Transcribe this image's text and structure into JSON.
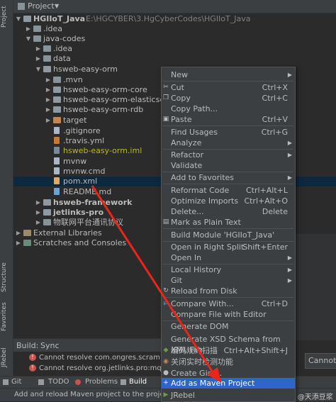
{
  "sidebar": {
    "project_tab": "Project",
    "structure_tab": "Structure",
    "favorites_tab": "Favorites",
    "jrebel_tab": "JRebel"
  },
  "header": {
    "title": "Project"
  },
  "tree": {
    "root_name": "HGIIoT_Java",
    "root_path": "E:\\HGCYBER\\3.HgCyberCodes\\HGIIoT_Java",
    "items": [
      ".idea",
      "java-codes",
      ".idea",
      "data",
      "hsweb-easy-orm",
      ".mvn",
      "hsweb-easy-orm-core",
      "hsweb-easy-orm-elasticsearch",
      "hsweb-easy-orm-rdb",
      "target",
      ".gitignore",
      ".travis.yml",
      "hsweb-easy-orm.iml",
      "mvnw",
      "mvnw.cmd",
      "pom.xml",
      "README.md",
      "hsweb-framework",
      "jetlinks-pro",
      "物联网平台通讯协议",
      "External Libraries",
      "Scratches and Consoles"
    ]
  },
  "menu": {
    "items": [
      {
        "label": "New",
        "shortcut": ""
      },
      {
        "label": "Cut",
        "shortcut": "Ctrl+X"
      },
      {
        "label": "Copy",
        "shortcut": "Ctrl+C"
      },
      {
        "label": "Copy Path...",
        "shortcut": ""
      },
      {
        "label": "Paste",
        "shortcut": "Ctrl+V"
      },
      {
        "label": "Find Usages",
        "shortcut": "Ctrl+G"
      },
      {
        "label": "Analyze",
        "shortcut": ""
      },
      {
        "label": "Refactor",
        "shortcut": ""
      },
      {
        "label": "Validate",
        "shortcut": ""
      },
      {
        "label": "Add to Favorites",
        "shortcut": ""
      },
      {
        "label": "Reformat Code",
        "shortcut": "Ctrl+Alt+L"
      },
      {
        "label": "Optimize Imports",
        "shortcut": "Ctrl+Alt+O"
      },
      {
        "label": "Delete...",
        "shortcut": "Delete"
      },
      {
        "label": "Mark as Plain Text",
        "shortcut": ""
      },
      {
        "label": "Build Module 'HGIIoT_Java'",
        "shortcut": ""
      },
      {
        "label": "Open in Right Split",
        "shortcut": "Shift+Enter"
      },
      {
        "label": "Open In",
        "shortcut": ""
      },
      {
        "label": "Local History",
        "shortcut": ""
      },
      {
        "label": "Git",
        "shortcut": ""
      },
      {
        "label": "Reload from Disk",
        "shortcut": ""
      },
      {
        "label": "Compare With...",
        "shortcut": "Ctrl+D"
      },
      {
        "label": "Compare File with Editor",
        "shortcut": ""
      },
      {
        "label": "Generate DOM",
        "shortcut": ""
      },
      {
        "label": "Generate XSD Schema from XML File...",
        "shortcut": ""
      },
      {
        "label": "编码规约扫描",
        "shortcut": "Ctrl+Alt+Shift+J"
      },
      {
        "label": "关闭实时检测功能",
        "shortcut": ""
      },
      {
        "label": "Create Gist...",
        "shortcut": ""
      },
      {
        "label": "Add as Maven Project",
        "shortcut": ""
      },
      {
        "label": "JRebel",
        "shortcut": ""
      }
    ]
  },
  "build": {
    "label": "Build:",
    "tab": "Sync",
    "errors": [
      "Cannot resolve com.ongres.scram:cli",
      "Cannot resolve org.jetlinks.pro:mqtt-"
    ]
  },
  "bottom_tabs": {
    "git": "Git",
    "todo": "TODO",
    "problems": "Problems",
    "build": "Build"
  },
  "status": {
    "message": "Add and reload Maven project to the projects tr",
    "watermark": "CSDN @天添豆浆"
  },
  "popup": {
    "text": "Cannot"
  },
  "colors": {
    "highlight": "#2f65ca",
    "arrow": "#e8261c",
    "selection": "#0d293e"
  }
}
